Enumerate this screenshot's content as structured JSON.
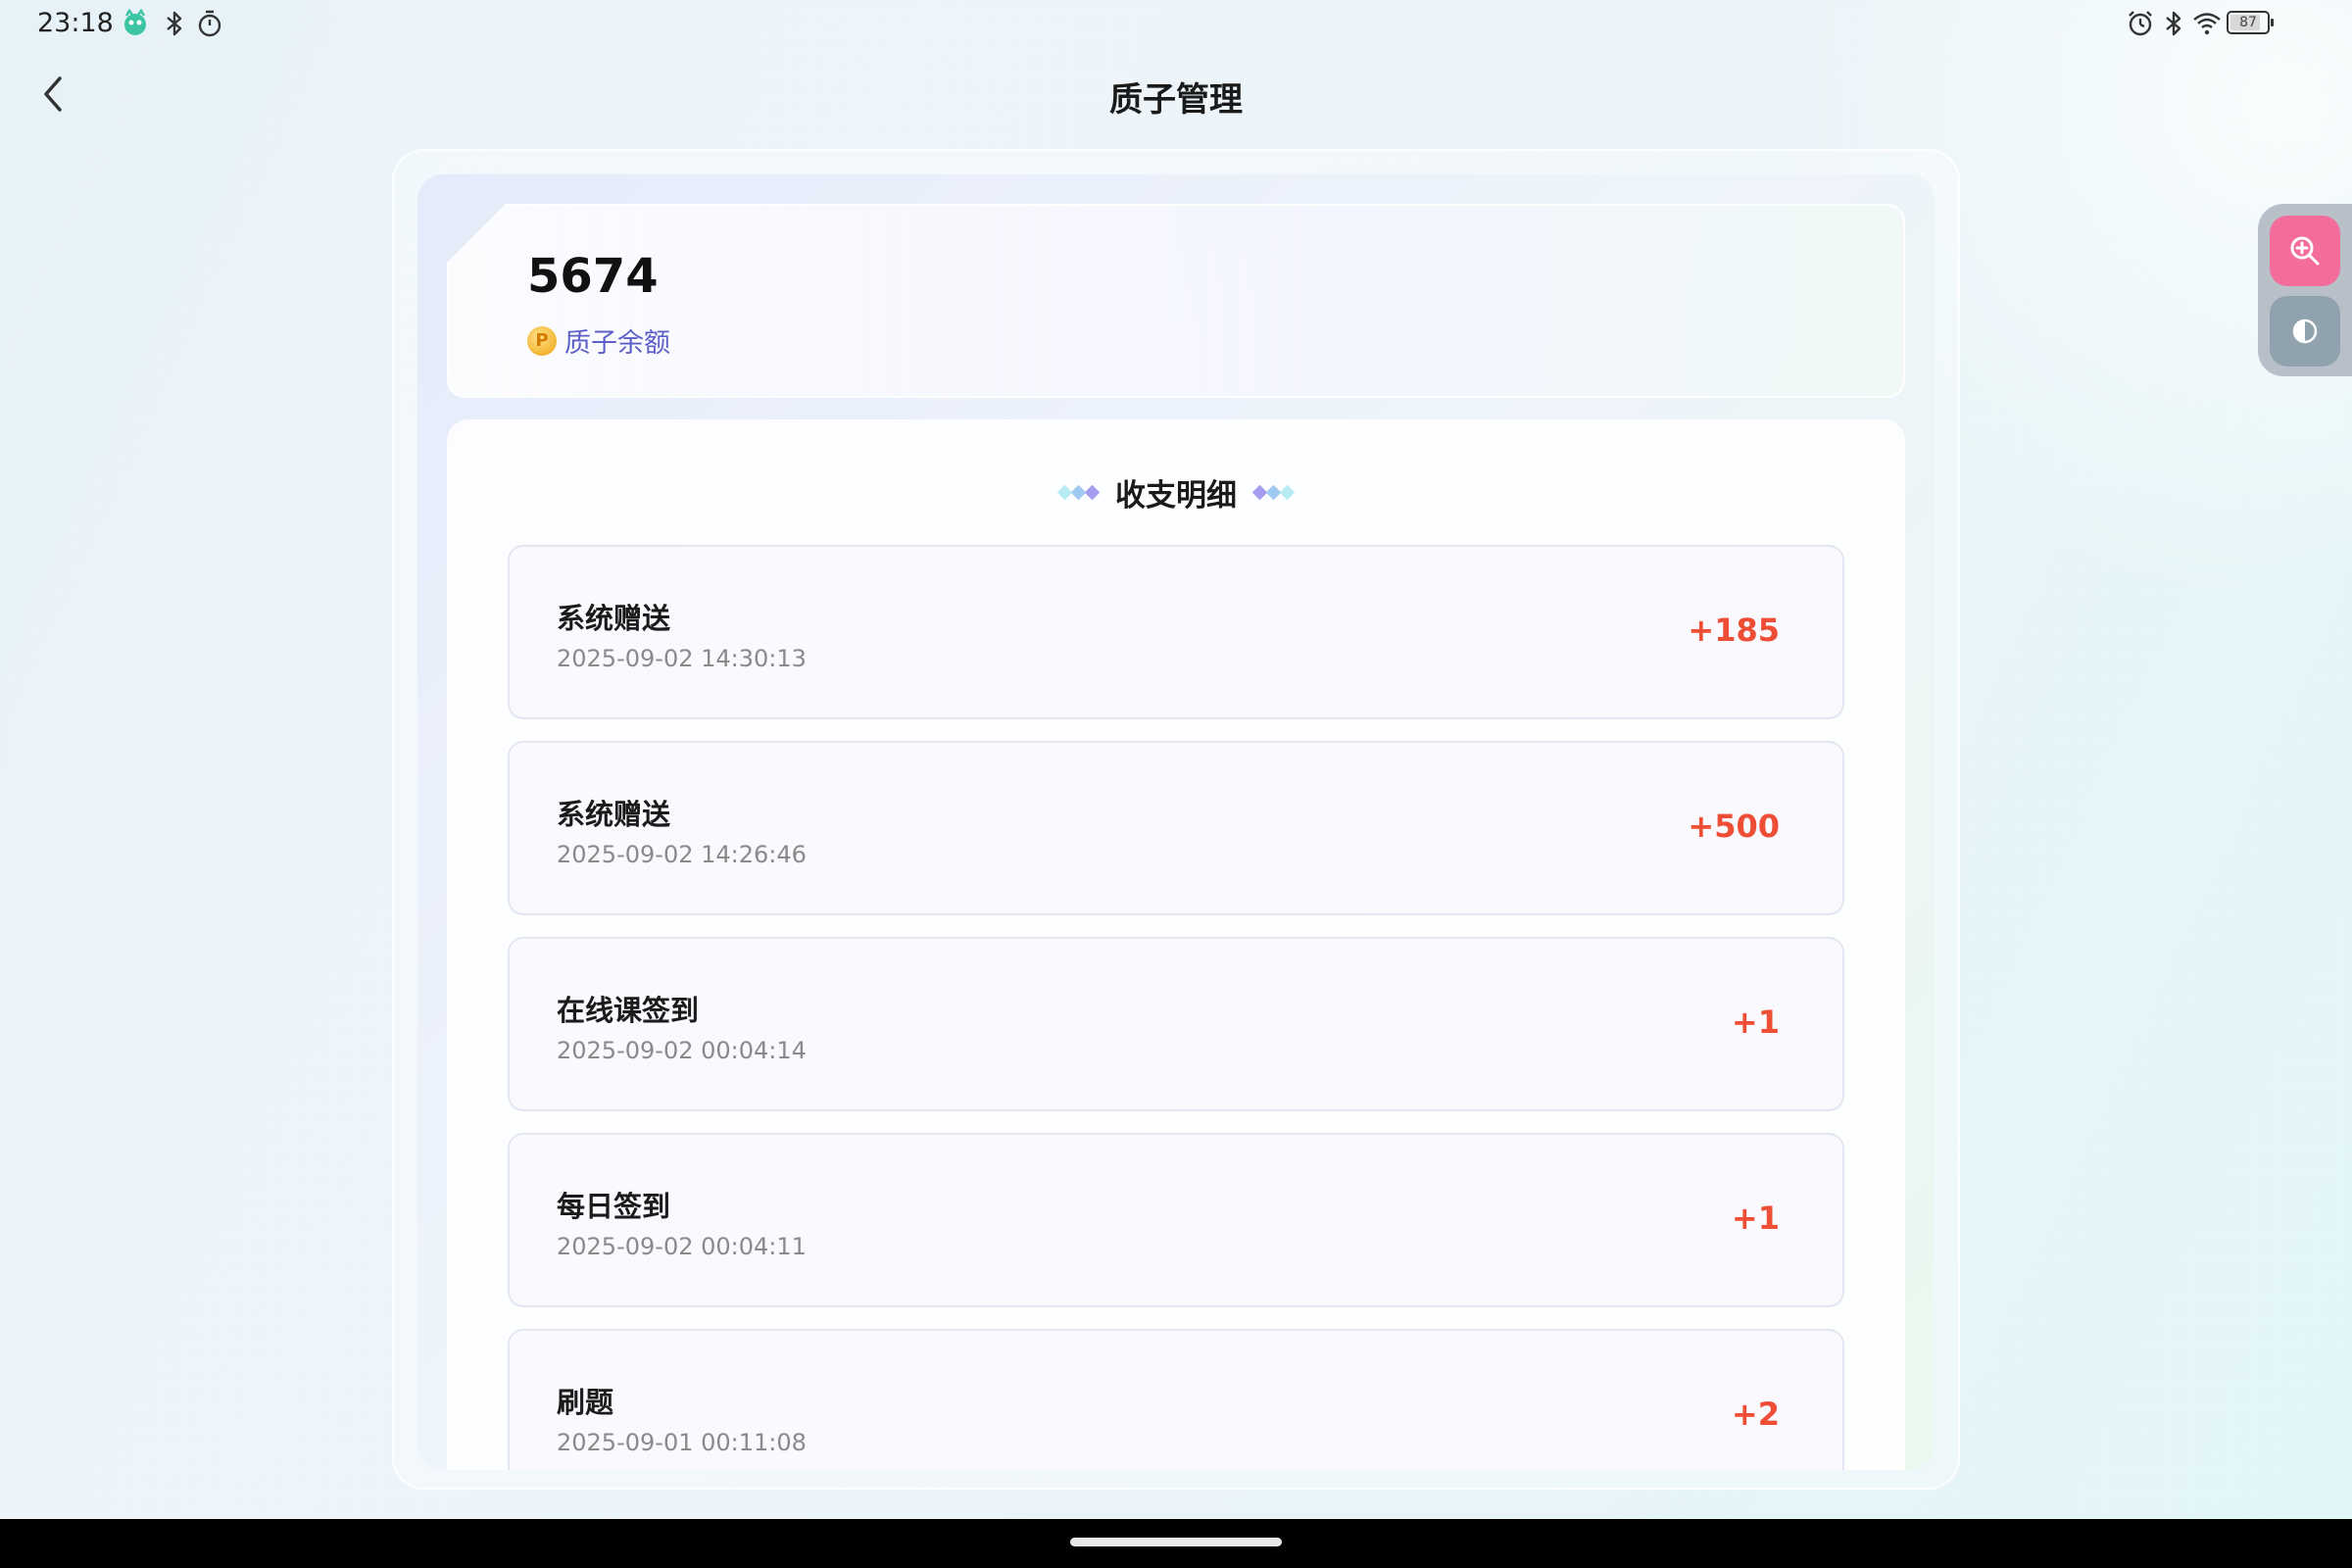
{
  "status_bar": {
    "time": "23:18",
    "battery_level": "87",
    "icons": [
      "app-notification-icon",
      "bluetooth-icon",
      "timer-icon",
      "alarm-icon",
      "bluetooth-icon",
      "wifi-icon",
      "battery-icon"
    ]
  },
  "header": {
    "title": "质子管理",
    "back_icon": "chevron-left-icon"
  },
  "balance": {
    "value": "5674",
    "label": "质子余额",
    "coin_glyph": "P"
  },
  "details": {
    "title": "收支明细",
    "transactions": [
      {
        "title": "系统赠送",
        "time": "2025-09-02 14:30:13",
        "amount": "+185"
      },
      {
        "title": "系统赠送",
        "time": "2025-09-02 14:26:46",
        "amount": "+500"
      },
      {
        "title": "在线课签到",
        "time": "2025-09-02 00:04:14",
        "amount": "+1"
      },
      {
        "title": "每日签到",
        "time": "2025-09-02 00:04:11",
        "amount": "+1"
      },
      {
        "title": "刷题",
        "time": "2025-09-01 00:11:08",
        "amount": "+2"
      }
    ]
  },
  "side_tools": {
    "zoom_icon": "zoom-in-icon",
    "contrast_icon": "contrast-icon"
  },
  "colors": {
    "accent_amount": "#ee4e36",
    "label_purple": "#5b5fc7",
    "zoom_pink": "#f46d9a"
  }
}
